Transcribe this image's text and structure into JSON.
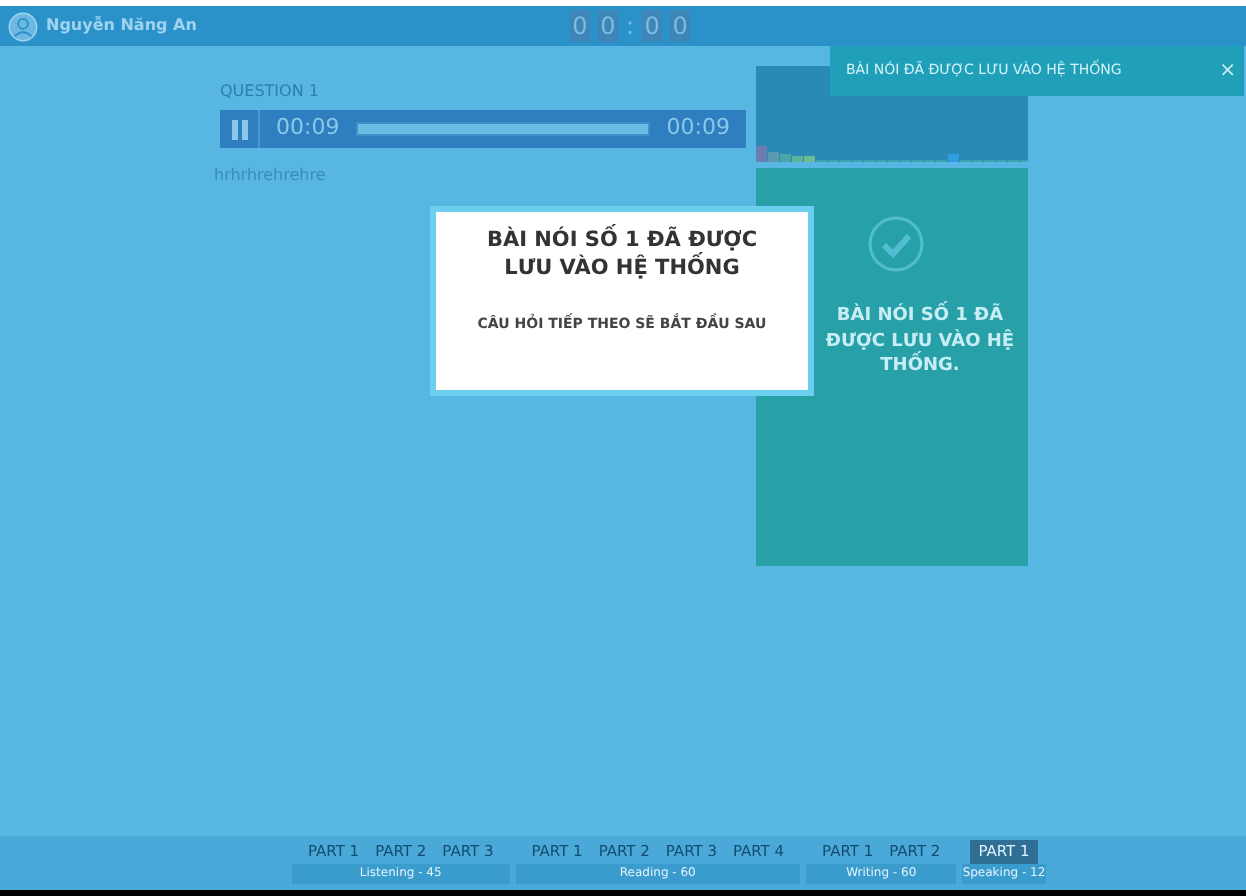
{
  "header": {
    "user": "Nguyễn Năng An",
    "timer": [
      "0",
      "0",
      ":",
      "0",
      "0"
    ]
  },
  "toast": {
    "message": "BÀI NÓI ĐÃ ĐƯỢC LƯU VÀO HỆ THỐNG",
    "close": "×"
  },
  "question": {
    "title": "QUESTION 1",
    "player": {
      "playing": true,
      "elapsed": "00:09",
      "level": 1,
      "duration": "00:09"
    },
    "answer": "hrhrhrehrehre"
  },
  "status_panel": {
    "message": "BÀI NÓI SỐ 1 ĐÃ ĐƯỢC LƯU VÀO HỆ THỐNG."
  },
  "modal": {
    "title": "BÀI NÓI SỐ 1 ĐÃ ĐƯỢC LƯU VÀO HỆ THỐNG",
    "subtitle": "CÂU HỎI TIẾP THEO SẼ BẮT ĐẦU SAU"
  },
  "sections": [
    {
      "label": "Listening - 45",
      "parts": [
        {
          "label": "PART 1",
          "selected": false
        },
        {
          "label": "PART 2",
          "selected": false
        },
        {
          "label": "PART 3",
          "selected": false
        }
      ]
    },
    {
      "label": "Reading - 60",
      "parts": [
        {
          "label": "PART 1",
          "selected": false
        },
        {
          "label": "PART 2",
          "selected": false
        },
        {
          "label": "PART 3",
          "selected": false
        },
        {
          "label": "PART 4",
          "selected": false
        }
      ]
    },
    {
      "label": "Writing - 60",
      "parts": [
        {
          "label": "PART 1",
          "selected": false
        },
        {
          "label": "PART 2",
          "selected": false
        }
      ]
    },
    {
      "label": "Speaking - 12",
      "parts": [
        {
          "label": "PART 1",
          "selected": true
        }
      ]
    }
  ]
}
